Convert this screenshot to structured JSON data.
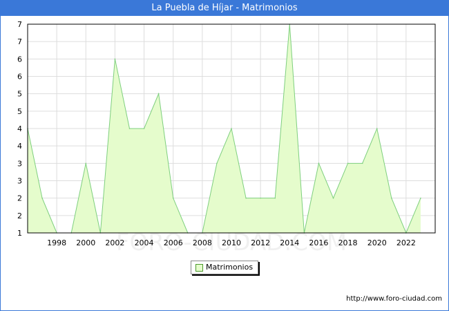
{
  "title": "La Puebla de Híjar - Matrimonios",
  "watermark": "FORO-CIUDAD.COM",
  "footer_url": "http://www.foro-ciudad.com",
  "colors": {
    "title_bar": "#3a78d8",
    "area_fill": "#e5fccc",
    "line": "#7ecf7e",
    "grid": "#dddddd"
  },
  "chart_data": {
    "type": "area",
    "title": "La Puebla de Híjar - Matrimonios",
    "series": [
      {
        "name": "Matrimonios",
        "x": [
          1996,
          1997,
          1998,
          1999,
          2000,
          2001,
          2002,
          2003,
          2004,
          2005,
          2006,
          2007,
          2008,
          2009,
          2010,
          2011,
          2012,
          2013,
          2014,
          2015,
          2016,
          2017,
          2018,
          2019,
          2020,
          2021,
          2022,
          2023
        ],
        "values": [
          4,
          2,
          1,
          1,
          3,
          1,
          6,
          4,
          4,
          5,
          2,
          1,
          1,
          3,
          4,
          2,
          2,
          2,
          7,
          1,
          3,
          2,
          3,
          3,
          4,
          2,
          1,
          2
        ]
      }
    ],
    "x_ticks": [
      "1998",
      "2000",
      "2002",
      "2004",
      "2006",
      "2008",
      "2010",
      "2012",
      "2014",
      "2016",
      "2018",
      "2020",
      "2022"
    ],
    "y_tick_labels": [
      "1",
      "2",
      "2",
      "3",
      "3",
      "4",
      "4",
      "5",
      "5",
      "6",
      "6",
      "7",
      "7"
    ],
    "ylim": [
      1,
      7
    ],
    "xlim": [
      1996,
      2024
    ],
    "grid": true,
    "legend": "bottom-center"
  }
}
